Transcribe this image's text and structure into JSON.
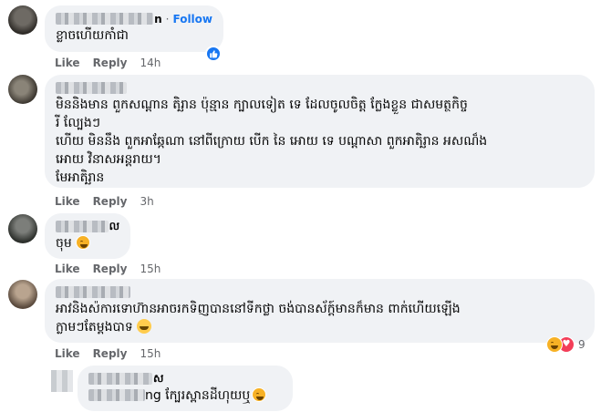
{
  "comments": [
    {
      "name_tail": "n",
      "separator": "·",
      "follow_label": "Follow",
      "lines": [
        "ខ្លាចហើយកាំជា"
      ],
      "like_label": "Like",
      "reply_label": "Reply",
      "time": "14h"
    },
    {
      "lines": [
        "មិននិងមាន ពួកសណ្ដាន តិរ្ឆាន ប៉ុន្មាន ក្បាលទៀត ទេ ដែលចូលចិត្ត ក្លែងខ្លួន ជាសមត្ថកិច្ច",
        "រី ល្បែងៗ",
        "ហើយ មិននឹង ពួកអាឆ្កែណា នៅពីក្រោយ បើក នៃ អោយ ទេ បណ្ដាសា ពួកអាតិរ្ឆាន អសណ៏ង",
        "អោយ វិនាសអន្តរាយ។",
        "មែអាតិរ្ឆាន"
      ],
      "like_label": "Like",
      "reply_label": "Reply",
      "time": "3h"
    },
    {
      "name_tail": "ល",
      "lines": [
        "ចុម"
      ],
      "like_label": "Like",
      "reply_label": "Reply",
      "time": "15h"
    },
    {
      "lines": [
        "អាវនិងស៉ការទោហ៊ានអាចរកទិញបាននៅទីកថ្លា ចង់បានស័ក្ត៍មានក៏មាន ពាក់ហើយឡើង",
        "ក្លាមៗតែម្ដងបាទ"
      ],
      "like_label": "Like",
      "reply_label": "Reply",
      "time": "15h",
      "reaction_count": "9"
    },
    {
      "name_tail": "ស",
      "text_prefix": "ng",
      "lines": [
        "ក្បែរស្ពានដីហុយឬ"
      ]
    }
  ],
  "icons": {
    "like": "like-icon",
    "haha": "haha-emoji-icon",
    "love": "love-icon",
    "smile": "smiling-emoji-icon"
  },
  "colors": {
    "bubble": "#f0f2f5",
    "accent": "#1877f2",
    "meta": "#65676b",
    "heart": "#f33e58"
  }
}
